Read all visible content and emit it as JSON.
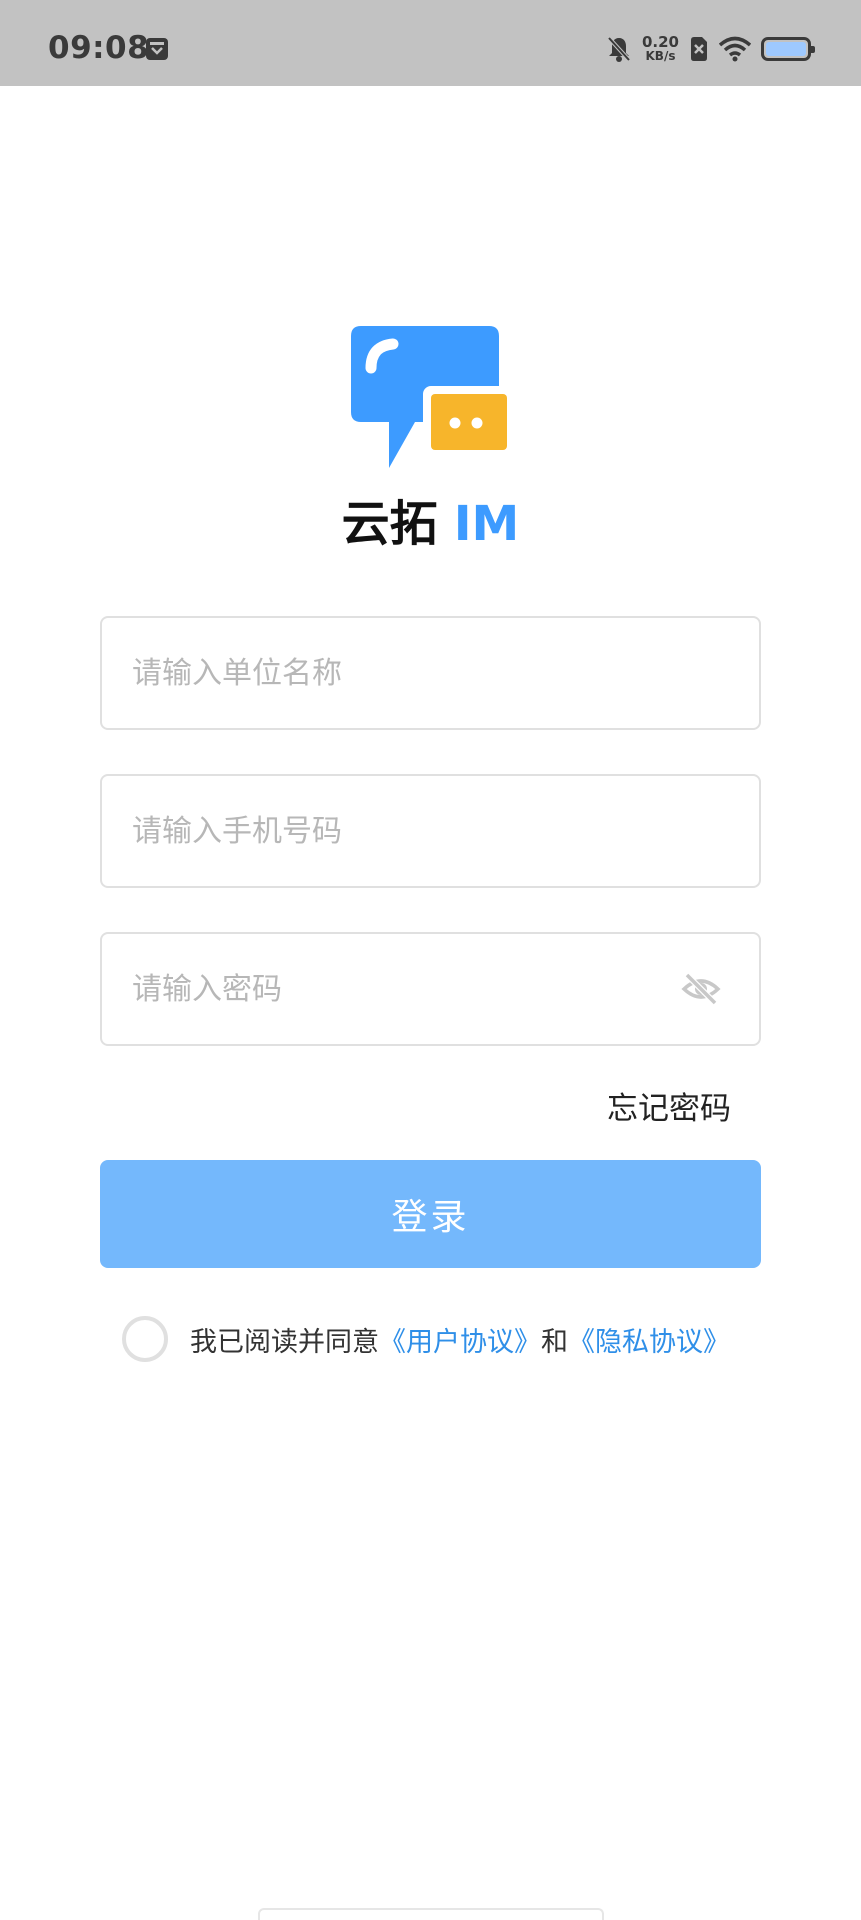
{
  "status_bar": {
    "time": "09:08",
    "net_speed_value": "0.20",
    "net_speed_unit": "KB/s"
  },
  "app": {
    "name_cn": "云拓",
    "name_en": "IM"
  },
  "form": {
    "company_placeholder": "请输入单位名称",
    "phone_placeholder": "请输入手机号码",
    "password_placeholder": "请输入密码",
    "forgot_label": "忘记密码",
    "login_label": "登录"
  },
  "agreement": {
    "prefix": "我已阅读并同意",
    "user_link": "《用户协议》",
    "conjunction": "和",
    "privacy_link": "《隐私协议》",
    "checked": false
  },
  "colors": {
    "brand_blue": "#3d9bff",
    "logo_yellow": "#f7b52b",
    "button_blue": "#74b8fc",
    "link_blue": "#2f8fe8"
  }
}
